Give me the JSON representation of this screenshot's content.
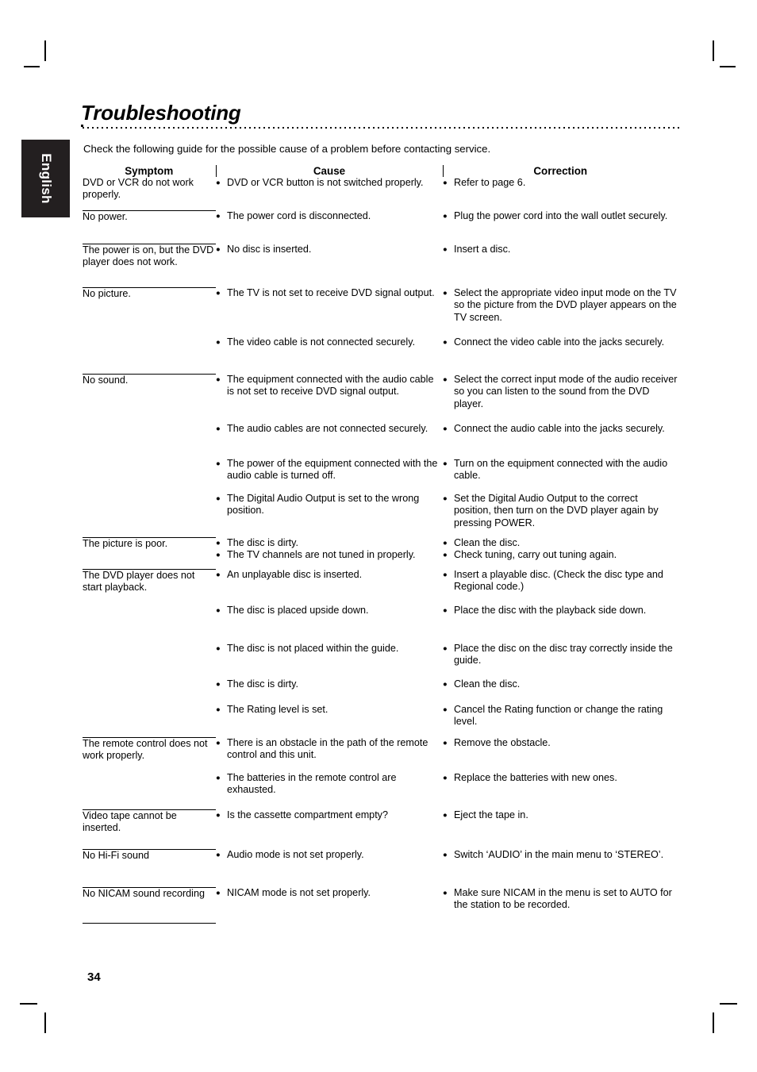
{
  "page": {
    "title": "Troubleshooting",
    "intro": "Check the following guide for the possible cause of a problem before contacting service.",
    "language_tab": "English",
    "page_number": "34"
  },
  "table": {
    "headers": {
      "symptom": "Symptom",
      "cause": "Cause",
      "correction": "Correction"
    },
    "groups": [
      {
        "symptom": "DVD or VCR do not work properly.",
        "rows": [
          {
            "causes": [
              "DVD or VCR button is not switched properly."
            ],
            "corrections": [
              "Refer to page 6."
            ]
          }
        ]
      },
      {
        "symptom": "No power.",
        "rows": [
          {
            "causes": [
              "The power cord is disconnected."
            ],
            "corrections": [
              "Plug the power cord into the wall outlet securely."
            ]
          }
        ]
      },
      {
        "symptom": "The power is on, but the DVD player does not work.",
        "rows": [
          {
            "causes": [
              "No disc is inserted."
            ],
            "corrections": [
              "Insert a disc."
            ]
          }
        ]
      },
      {
        "symptom": "No picture.",
        "rows": [
          {
            "causes": [
              "The TV is not set to receive DVD signal output."
            ],
            "corrections": [
              "Select the appropriate video input mode on the TV so the picture from the DVD player appears on the TV screen."
            ]
          },
          {
            "causes": [
              "The video cable is not connected securely."
            ],
            "corrections": [
              "Connect the video cable into the jacks securely."
            ]
          }
        ]
      },
      {
        "symptom": "No sound.",
        "rows": [
          {
            "causes": [
              "The equipment connected with the audio cable is not set to receive DVD signal output."
            ],
            "corrections": [
              "Select the correct input mode of the audio receiver so you can listen to the sound from the DVD player."
            ]
          },
          {
            "causes": [
              "The audio cables are not connected securely."
            ],
            "corrections": [
              "Connect the audio cable into the jacks securely."
            ]
          },
          {
            "causes": [
              "The power of the equipment connected with the audio cable is turned off."
            ],
            "corrections": [
              "Turn on the equipment connected with the audio cable."
            ]
          },
          {
            "causes": [
              "The Digital Audio Output is set to the wrong position."
            ],
            "corrections": [
              "Set the Digital Audio Output to the correct position, then turn on the DVD player again by pressing POWER."
            ]
          }
        ]
      },
      {
        "symptom": "The picture is  poor.",
        "rows": [
          {
            "causes": [
              "The disc is dirty.",
              "The TV channels are not tuned in properly."
            ],
            "corrections": [
              "Clean the disc.",
              "Check tuning, carry out tuning again."
            ]
          }
        ]
      },
      {
        "symptom": "The DVD player does not start playback.",
        "rows": [
          {
            "causes": [
              "An unplayable disc is inserted."
            ],
            "corrections": [
              "Insert a playable disc. (Check the disc type and Regional code.)"
            ]
          },
          {
            "causes": [
              "The disc is placed upside down."
            ],
            "corrections": [
              "Place the disc with the playback side down."
            ]
          },
          {
            "causes": [
              "The disc is not placed within the guide."
            ],
            "corrections": [
              "Place the disc on the disc tray correctly inside the guide."
            ]
          },
          {
            "causes": [
              "The disc is dirty."
            ],
            "corrections": [
              "Clean the disc."
            ]
          },
          {
            "causes": [
              "The Rating level is set."
            ],
            "corrections": [
              "Cancel the Rating function or change the rating  level."
            ]
          }
        ]
      },
      {
        "symptom": "The remote control does not work properly.",
        "rows": [
          {
            "causes": [
              "There is an obstacle in the path of the remote control and this unit."
            ],
            "corrections": [
              "Remove the obstacle."
            ]
          },
          {
            "causes": [
              "The batteries in the remote control are exhausted."
            ],
            "corrections": [
              "Replace the batteries with new ones."
            ]
          }
        ]
      },
      {
        "symptom": "Video tape cannot be inserted.",
        "rows": [
          {
            "causes": [
              "Is the cassette compartment empty?"
            ],
            "corrections": [
              "Eject the tape in."
            ]
          }
        ]
      },
      {
        "symptom": "No Hi-Fi sound",
        "rows": [
          {
            "causes": [
              "Audio mode is not set properly."
            ],
            "corrections": [
              "Switch ‘AUDIO’ in the main menu to ‘STEREO’."
            ]
          }
        ]
      },
      {
        "symptom": "No NICAM sound recording",
        "rows": [
          {
            "causes": [
              "NICAM mode is not set properly."
            ],
            "corrections": [
              "Make sure NICAM in the menu is set to AUTO for the station to be recorded."
            ]
          }
        ]
      }
    ]
  }
}
